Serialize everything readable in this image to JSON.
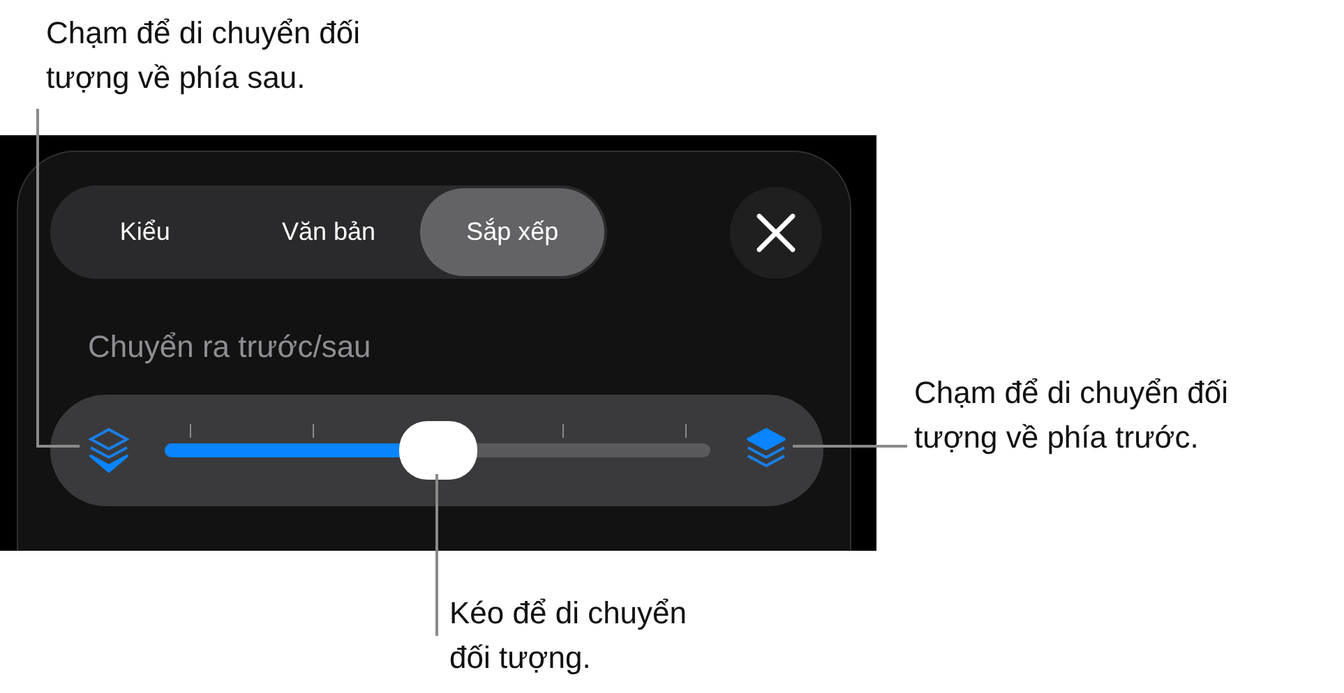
{
  "tabs": [
    {
      "label": "Kiểu",
      "selected": false
    },
    {
      "label": "Văn bản",
      "selected": false
    },
    {
      "label": "Sắp xếp",
      "selected": true
    }
  ],
  "section_title": "Chuyển ra trước/sau",
  "slider": {
    "level": 0.5
  },
  "callouts": [
    {
      "text": "Chạm để di chuyển đối\ntượng về phía sau.",
      "kind": "back"
    },
    {
      "text": "Chạm để di chuyển đối\ntượng về phía trước.",
      "kind": "front"
    },
    {
      "text": "Kéo để di chuyển\nđối tượng.",
      "kind": "thumb"
    }
  ]
}
